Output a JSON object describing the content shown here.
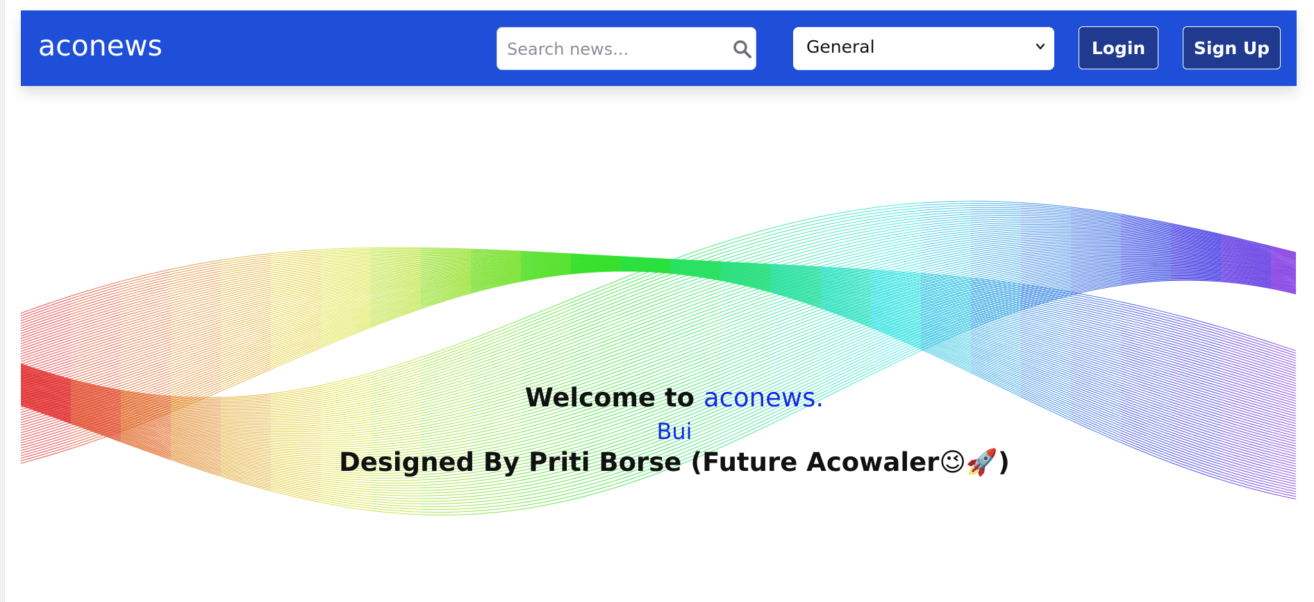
{
  "header": {
    "brand": "aconews",
    "search": {
      "placeholder": "Search news...",
      "value": ""
    },
    "category": {
      "selected": "General"
    },
    "login_label": "Login",
    "signup_label": "Sign Up",
    "colors": {
      "navbar": "#1f4fd8",
      "button": "#203a8f"
    }
  },
  "hero": {
    "welcome_prefix": "Welcome to ",
    "welcome_brand": "aconews.",
    "typed_text": "Bui",
    "designed_by": "Designed By Priti Borse (Future Acowaler",
    "emojis": "😉🚀",
    "designed_suffix": ")",
    "accent_color": "#1428e6"
  }
}
